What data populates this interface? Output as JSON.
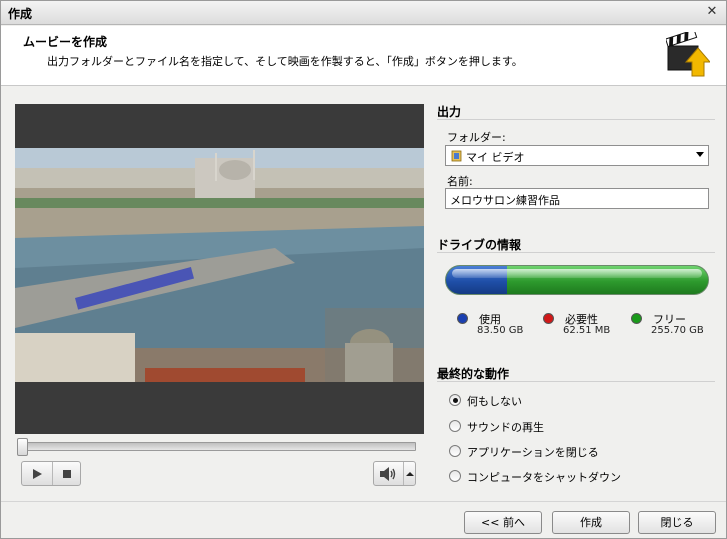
{
  "window": {
    "title": "作成",
    "close_glyph": "✕"
  },
  "header": {
    "title": "ムービーを作成",
    "description": "出力フォルダーとファイル名を指定して、そして映画を作製すると、「作成」ボタンを押します。"
  },
  "output": {
    "section_title": "出力",
    "folder_label": "フォルダー:",
    "folder_value": "マイ ビデオ",
    "name_label": "名前:",
    "name_value": "メロウサロン練習作品"
  },
  "drive": {
    "section_title": "ドライブの情報",
    "used_fraction": 0.2322,
    "required_fraction": 0.0001,
    "legend": [
      {
        "name": "使用",
        "size": "83.50 GB",
        "color": "#1a3fb0"
      },
      {
        "name": "必要性",
        "size": "62.51 MB",
        "color": "#d01818"
      },
      {
        "name": "フリー",
        "size": "255.70 GB",
        "color": "#1a9a1a"
      }
    ]
  },
  "final_action": {
    "section_title": "最終的な動作",
    "options": [
      {
        "label": "何もしない",
        "selected": true
      },
      {
        "label": "サウンドの再生",
        "selected": false
      },
      {
        "label": "アプリケーションを閉じる",
        "selected": false
      },
      {
        "label": "コンピュータをシャットダウン",
        "selected": false
      }
    ]
  },
  "player": {
    "seek_position": 0.0,
    "play_icon": "play-icon",
    "stop_icon": "stop-icon",
    "volume_icon": "speaker-icon"
  },
  "buttons": {
    "back": "<< 前へ",
    "create": "作成",
    "close": "閉じる"
  }
}
